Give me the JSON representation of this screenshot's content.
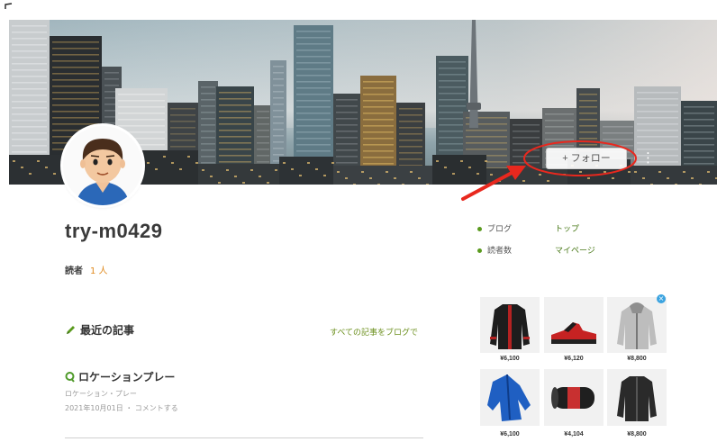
{
  "colors": {
    "accent": "#5a9a1e",
    "link": "#6b8f1c",
    "reader_value": "#e08a1e",
    "annotation": "#e8281e",
    "text": "#333333",
    "muted": "#9a9a9a",
    "ad_close": "#3aa3e0"
  },
  "header": {
    "banner_image": "city-skyline-image",
    "follow_label": "+ フォロー",
    "menu_glyph": "⋮",
    "menu_icon": "more-vertical-icon"
  },
  "profile": {
    "avatar_icon": "cartoon-avatar-icon",
    "username": "try-m0429",
    "readers_label": "読者",
    "readers_value": "1 人"
  },
  "info": [
    {
      "label": "ブログ",
      "value": "トップ"
    },
    {
      "label": "読者数",
      "value": "マイページ"
    }
  ],
  "recent": {
    "icon": "pencil-icon",
    "heading": "最近の記事",
    "more_link": "すべての記事をブログで"
  },
  "articles": [
    {
      "icon": "location-icon",
      "title": "ロケーションプレー",
      "excerpt": "ロケーション・プレー",
      "meta": "2021年10月01日 ・ コメントする"
    }
  ],
  "ad": {
    "close_glyph": "×",
    "close_icon": "close-icon",
    "items": [
      {
        "image": "black-red-jacket-icon",
        "price": "¥6,100"
      },
      {
        "image": "red-shoe-icon",
        "price": "¥6,120"
      },
      {
        "image": "grey-hoodie-icon",
        "price": "¥8,800"
      },
      {
        "image": "blue-jacket-icon",
        "price": "¥6,100"
      },
      {
        "image": "foam-roller-icon",
        "price": "¥4,104"
      },
      {
        "image": "black-jacket-icon",
        "price": "¥8,800"
      }
    ]
  }
}
